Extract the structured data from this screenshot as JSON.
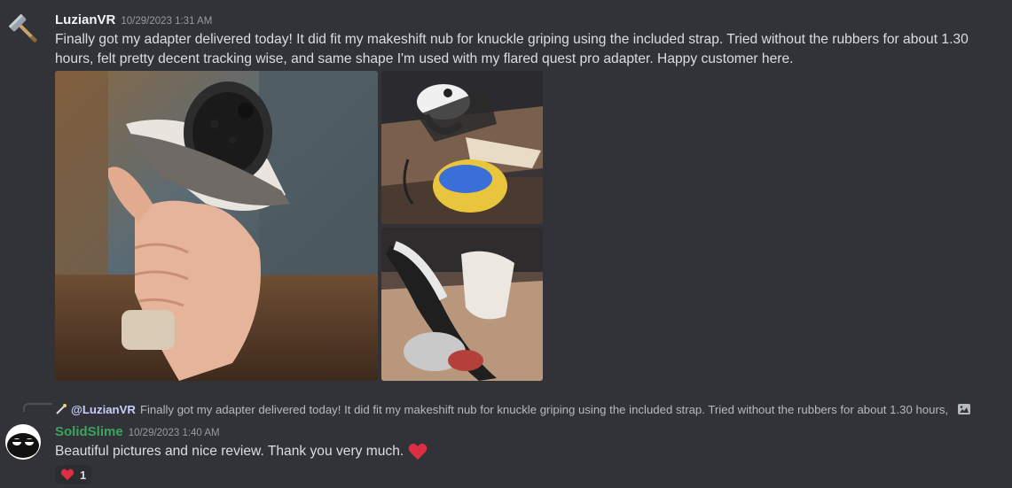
{
  "messages": [
    {
      "username": "LuzianVR",
      "username_color": "#f2f3f5",
      "timestamp": "10/29/2023 1:31 AM",
      "text": "Finally got my adapter delivered today! It did fit my makeshift nub for knuckle griping using the included strap. Tried without the rubbers for about 1.30 hours, felt pretty decent tracking wise, and same shape I'm used with my flared quest pro adapter. Happy customer here.",
      "avatar_icon": "hammer-avatar-icon",
      "attachments": [
        {
          "name": "photo-hand-holding-controller"
        },
        {
          "name": "photo-controller-on-desk"
        },
        {
          "name": "photo-adapter-side-view"
        }
      ]
    },
    {
      "reply": {
        "mention": "@LuzianVR",
        "preview": "Finally got my adapter delivered today! It did fit my makeshift nub for knuckle griping using the included strap. Tried without the rubbers for about 1.30 hours,",
        "icon": "image-attachment-icon"
      },
      "username": "SolidSlime",
      "username_color": "#3ba55c",
      "timestamp": "10/29/2023 1:40 AM",
      "text": "Beautiful pictures and nice review. Thank you very much.",
      "emoji": "heart-emoji",
      "reaction": {
        "emoji": "heart-emoji",
        "count": "1"
      }
    }
  ],
  "colors": {
    "background": "#313338",
    "heart": "#dd2e44",
    "mention": "#c9cdfb"
  }
}
